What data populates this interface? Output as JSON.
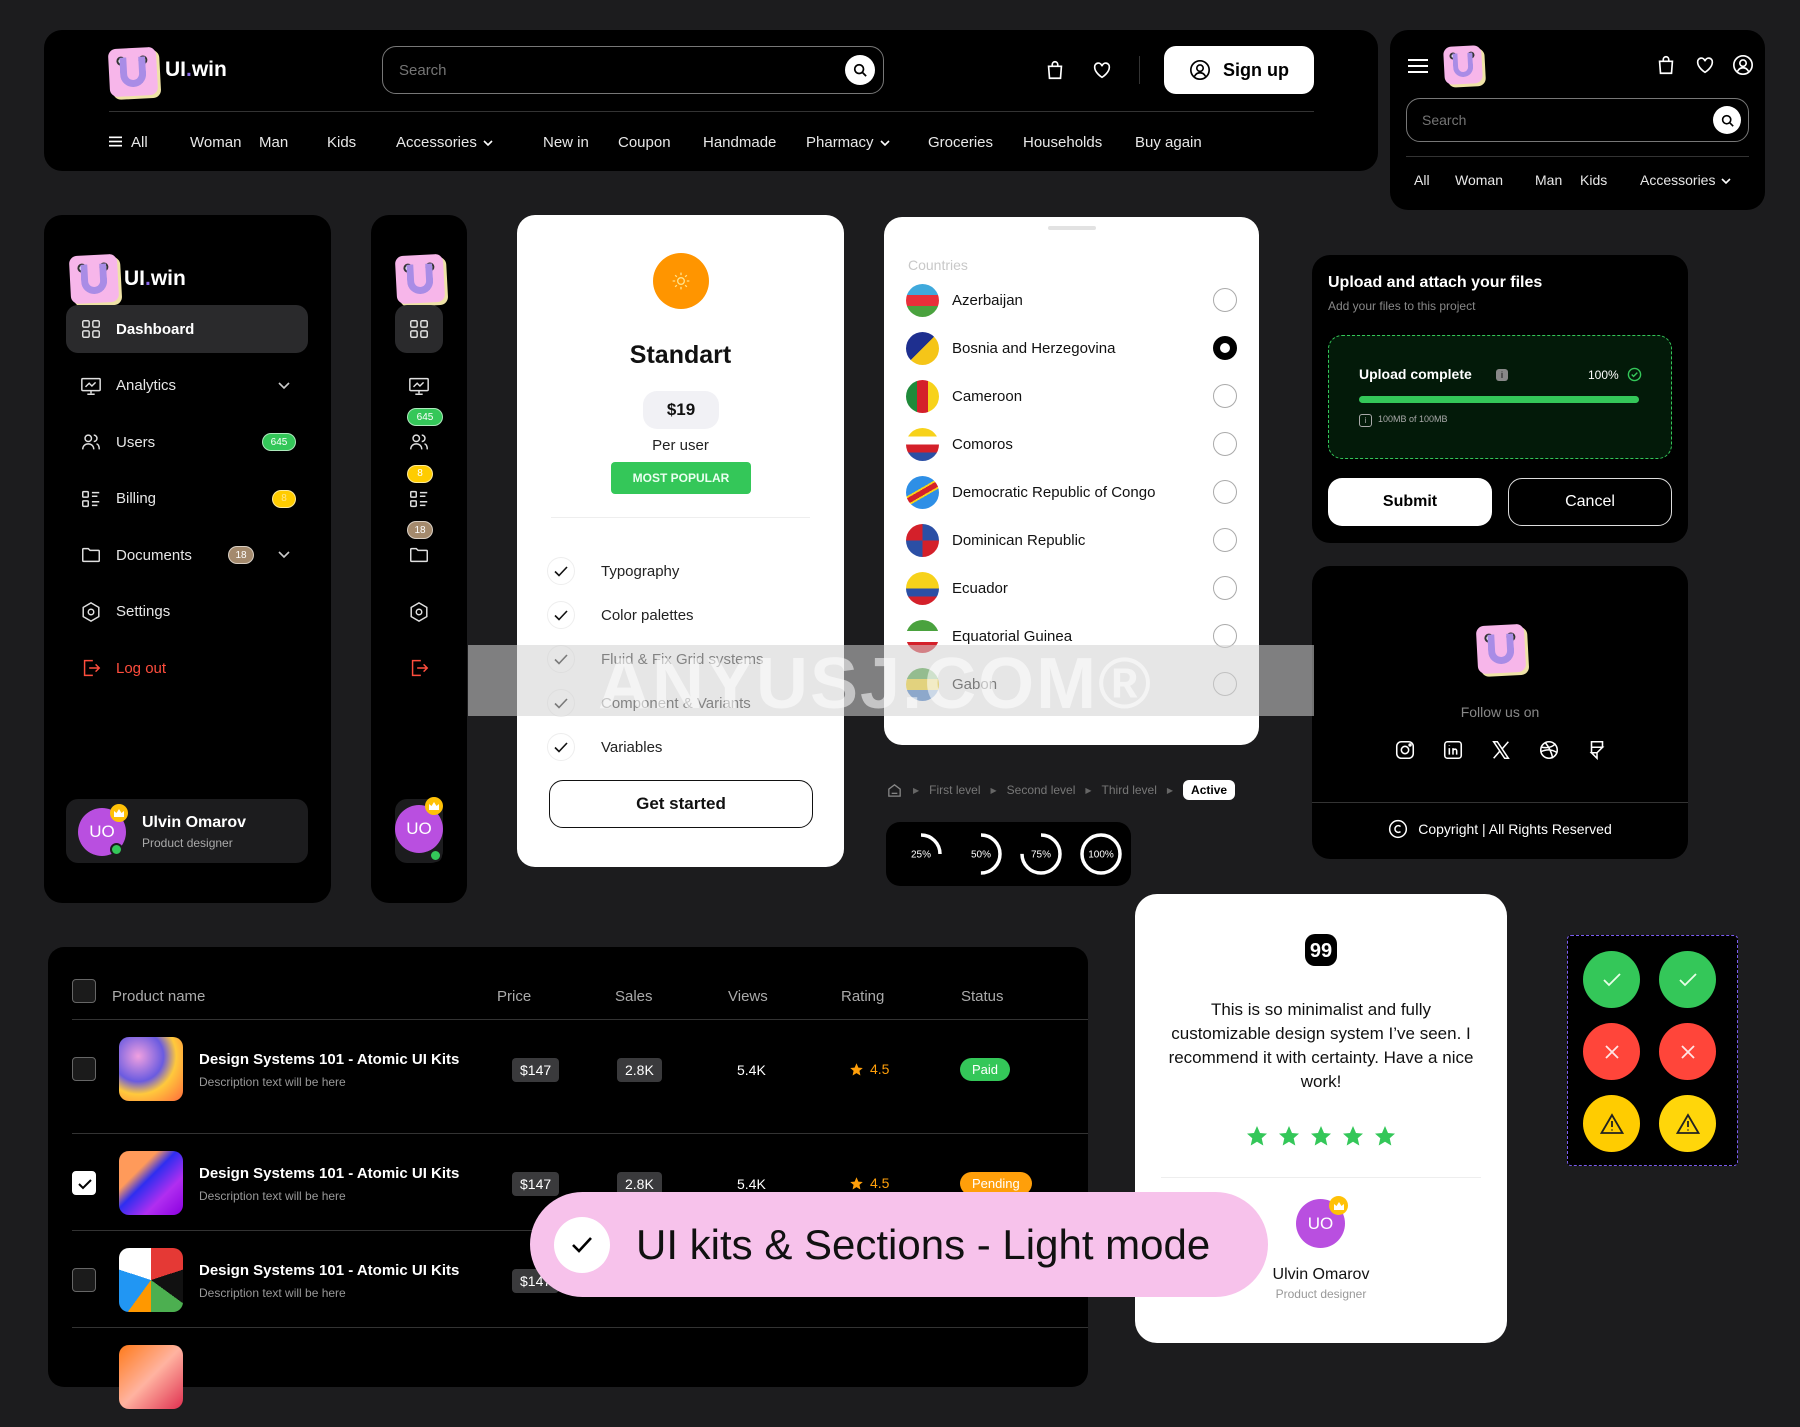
{
  "brand": {
    "name_prefix": "UI",
    "name_dot": ".",
    "name_suffix": "win"
  },
  "header": {
    "search_placeholder": "Search",
    "signup_label": "Sign up",
    "nav": [
      {
        "label": "All",
        "icon": "menu-icon"
      },
      {
        "label": "Woman"
      },
      {
        "label": "Man"
      },
      {
        "label": "Kids"
      },
      {
        "label": "Accessories",
        "dropdown": true
      },
      {
        "label": "New in"
      },
      {
        "label": "Coupon"
      },
      {
        "label": "Handmade"
      },
      {
        "label": "Pharmacy",
        "dropdown": true
      },
      {
        "label": "Groceries"
      },
      {
        "label": "Households"
      },
      {
        "label": "Buy again"
      }
    ]
  },
  "mobile_header": {
    "search_placeholder": "Search",
    "nav": [
      {
        "label": "All"
      },
      {
        "label": "Woman"
      },
      {
        "label": "Man"
      },
      {
        "label": "Kids"
      },
      {
        "label": "Accessories",
        "dropdown": true
      }
    ]
  },
  "sidebar": {
    "items": [
      {
        "label": "Dashboard",
        "icon": "grid-icon",
        "active": true
      },
      {
        "label": "Analytics",
        "icon": "presentation-chart-icon",
        "expandable": true
      },
      {
        "label": "Users",
        "icon": "users-icon",
        "badge": "645",
        "badge_color": "#34c759"
      },
      {
        "label": "Billing",
        "icon": "list-icon",
        "badge": "8",
        "badge_color": "#ffcc00"
      },
      {
        "label": "Documents",
        "icon": "folder-icon",
        "badge": "18",
        "badge_color": "#a48a6d",
        "expandable": true
      },
      {
        "label": "Settings",
        "icon": "settings-hex-icon"
      },
      {
        "label": "Log out",
        "icon": "logout-icon",
        "color": "#ff4d3d"
      }
    ],
    "user": {
      "initials": "UO",
      "name": "Ulvin Omarov",
      "role": "Product designer"
    }
  },
  "pricing": {
    "plan": "Standart",
    "price": "$19",
    "period": "Per user",
    "tag": "MOST POPULAR",
    "features": [
      "Typography",
      "Color palettes",
      "Fluid & Fix Grid systems",
      "Component & Variants",
      "Variables"
    ],
    "cta": "Get started"
  },
  "countries": {
    "title": "Countries",
    "selected": "Bosnia and Herzegovina",
    "items": [
      "Azerbaijan",
      "Bosnia and Herzegovina",
      "Cameroon",
      "Comoros",
      "Democratic Republic of Congo",
      "Dominican Republic",
      "Ecuador",
      "Equatorial Guinea",
      "Gabon"
    ]
  },
  "breadcrumb": {
    "items": [
      "First level",
      "Second level",
      "Third level"
    ],
    "active": "Active"
  },
  "progress_rings": [
    {
      "label": "25%",
      "value": 0.25
    },
    {
      "label": "50%",
      "value": 0.5
    },
    {
      "label": "75%",
      "value": 0.75
    },
    {
      "label": "100%",
      "value": 1.0
    }
  ],
  "upload": {
    "title": "Upload and attach your files",
    "subtitle": "Add your files to this project",
    "status": "Upload complete",
    "percent_label": "100%",
    "progress": 1.0,
    "size": "100MB of 100MB",
    "submit": "Submit",
    "cancel": "Cancel"
  },
  "footer": {
    "follow": "Follow us on",
    "socials": [
      "instagram-icon",
      "linkedin-icon",
      "x-icon",
      "dribbble-icon",
      "framer-icon"
    ],
    "copyright": "Copyright | All Rights Reserved"
  },
  "table": {
    "headers": [
      "Product name",
      "Price",
      "Sales",
      "Views",
      "Rating",
      "Status"
    ],
    "rows": [
      {
        "checked": false,
        "title": "Design Systems 101 - Atomic UI Kits",
        "desc": "Description text will be here",
        "price": "$147",
        "sales": "2.8K",
        "views": "5.4K",
        "rating": "4.5",
        "status": "Paid",
        "status_color": "#34c759"
      },
      {
        "checked": true,
        "title": "Design Systems 101 - Atomic UI Kits",
        "desc": "Description text will be here",
        "price": "$147",
        "sales": "2.8K",
        "views": "5.4K",
        "rating": "4.5",
        "status": "Pending",
        "status_color": "#ff9f0a"
      },
      {
        "checked": false,
        "title": "Design Systems 101 - Atomic UI Kits",
        "desc": "Description text will be here",
        "price": "$147"
      }
    ]
  },
  "testimonial": {
    "quote": "This is so minimalist and fully customizable design system I’ve seen. I recommend it with certainty. Have a nice work!",
    "stars": 5,
    "initials": "UO",
    "name": "Ulvin Omarov",
    "role": "Product designer"
  },
  "status_icons": [
    {
      "type": "success",
      "color": "#34c759"
    },
    {
      "type": "success",
      "color": "#34c759"
    },
    {
      "type": "error",
      "color": "#ff453a"
    },
    {
      "type": "error",
      "color": "#ff453a"
    },
    {
      "type": "warning",
      "color": "#ffcc00"
    },
    {
      "type": "warning",
      "color": "#ffd60a"
    }
  ],
  "banner": {
    "text": "UI kits & Sections - Light mode"
  },
  "watermark": {
    "text": "ANYUSJ.COM®"
  }
}
